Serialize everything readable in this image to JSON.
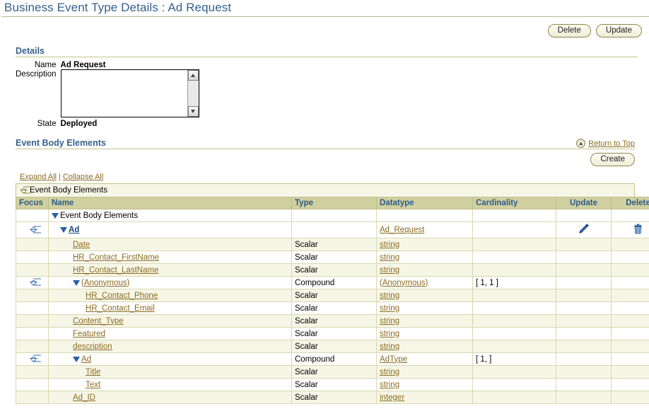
{
  "page": {
    "title": "Business Event Type Details : Ad Request"
  },
  "toolbar": {
    "delete_label": "Delete",
    "update_label": "Update"
  },
  "details": {
    "heading": "Details",
    "name_label": "Name",
    "name_value": "Ad Request",
    "description_label": "Description",
    "description_value": "",
    "state_label": "State",
    "state_value": "Deployed"
  },
  "event_body": {
    "heading": "Event Body Elements",
    "return_to_top": "Return to Top",
    "return_to_top_icon": "circle-up-arrow-icon",
    "create_label": "Create",
    "expand_all": "Expand All",
    "collapse_all": "Collapse All",
    "separator": "|",
    "tree_root_label": "Event Body Elements",
    "columns": [
      "Focus",
      "Name",
      "Type",
      "Datatype",
      "Cardinality",
      "Update",
      "Delete"
    ],
    "rows": [
      {
        "focus": false,
        "indent": 0,
        "expanded": true,
        "name": "Event Body Elements",
        "link": "none",
        "type": "",
        "datatype": "",
        "cardinality": "",
        "update": "",
        "delete": "",
        "shade": "node"
      },
      {
        "focus": true,
        "indent": 1,
        "expanded": true,
        "name": "Ad",
        "link": "blue",
        "type": "",
        "datatype": "Ad_Request",
        "cardinality": "",
        "update": "pencil-icon",
        "delete": "trash-icon",
        "shade": "node"
      },
      {
        "focus": false,
        "indent": 2,
        "expanded": false,
        "name": "Date",
        "link": "brown",
        "type": "Scalar",
        "datatype": "string",
        "cardinality": "",
        "update": "",
        "delete": "",
        "shade": "alt"
      },
      {
        "focus": false,
        "indent": 2,
        "expanded": false,
        "name": "HR_Contact_FirstName",
        "link": "brown",
        "type": "Scalar",
        "datatype": "string",
        "cardinality": "",
        "update": "",
        "delete": "",
        "shade": "plain"
      },
      {
        "focus": false,
        "indent": 2,
        "expanded": false,
        "name": "HR_Contact_LastName",
        "link": "brown",
        "type": "Scalar",
        "datatype": "string",
        "cardinality": "",
        "update": "",
        "delete": "",
        "shade": "alt"
      },
      {
        "focus": true,
        "indent": 2,
        "expanded": true,
        "name": "(Anonymous)",
        "link": "brown",
        "type": "Compound",
        "datatype": "(Anonymous)",
        "cardinality": "[ 1, 1 ]",
        "update": "",
        "delete": "",
        "shade": "plain"
      },
      {
        "focus": false,
        "indent": 3,
        "expanded": false,
        "name": "HR_Contact_Phone",
        "link": "brown",
        "type": "Scalar",
        "datatype": "string",
        "cardinality": "",
        "update": "",
        "delete": "",
        "shade": "alt"
      },
      {
        "focus": false,
        "indent": 3,
        "expanded": false,
        "name": "HR_Contact_Email",
        "link": "brown",
        "type": "Scalar",
        "datatype": "string",
        "cardinality": "",
        "update": "",
        "delete": "",
        "shade": "plain"
      },
      {
        "focus": false,
        "indent": 2,
        "expanded": false,
        "name": "Content_Type",
        "link": "brown",
        "type": "Scalar",
        "datatype": "string",
        "cardinality": "",
        "update": "",
        "delete": "",
        "shade": "alt"
      },
      {
        "focus": false,
        "indent": 2,
        "expanded": false,
        "name": "Featured",
        "link": "brown",
        "type": "Scalar",
        "datatype": "string",
        "cardinality": "",
        "update": "",
        "delete": "",
        "shade": "plain"
      },
      {
        "focus": false,
        "indent": 2,
        "expanded": false,
        "name": "description",
        "link": "brown",
        "type": "Scalar",
        "datatype": "string",
        "cardinality": "",
        "update": "",
        "delete": "",
        "shade": "alt"
      },
      {
        "focus": true,
        "indent": 2,
        "expanded": true,
        "name": "Ad",
        "link": "brown",
        "type": "Compound",
        "datatype": "AdType",
        "cardinality": "[ 1, ]",
        "update": "",
        "delete": "",
        "shade": "plain"
      },
      {
        "focus": false,
        "indent": 3,
        "expanded": false,
        "name": "Title",
        "link": "brown",
        "type": "Scalar",
        "datatype": "string",
        "cardinality": "",
        "update": "",
        "delete": "",
        "shade": "alt"
      },
      {
        "focus": false,
        "indent": 3,
        "expanded": false,
        "name": "Text",
        "link": "brown",
        "type": "Scalar",
        "datatype": "string",
        "cardinality": "",
        "update": "",
        "delete": "",
        "shade": "plain"
      },
      {
        "focus": false,
        "indent": 2,
        "expanded": false,
        "name": "Ad_ID",
        "link": "brown",
        "type": "Scalar",
        "datatype": "integer",
        "cardinality": "",
        "update": "",
        "delete": "",
        "shade": "alt"
      }
    ]
  },
  "colors": {
    "title_blue": "#36618E",
    "link_brown": "#8C6B1F",
    "header_tan": "#CFCF9F",
    "row_cream": "#F6F6E7",
    "icon_blue": "#2A5DA8"
  }
}
